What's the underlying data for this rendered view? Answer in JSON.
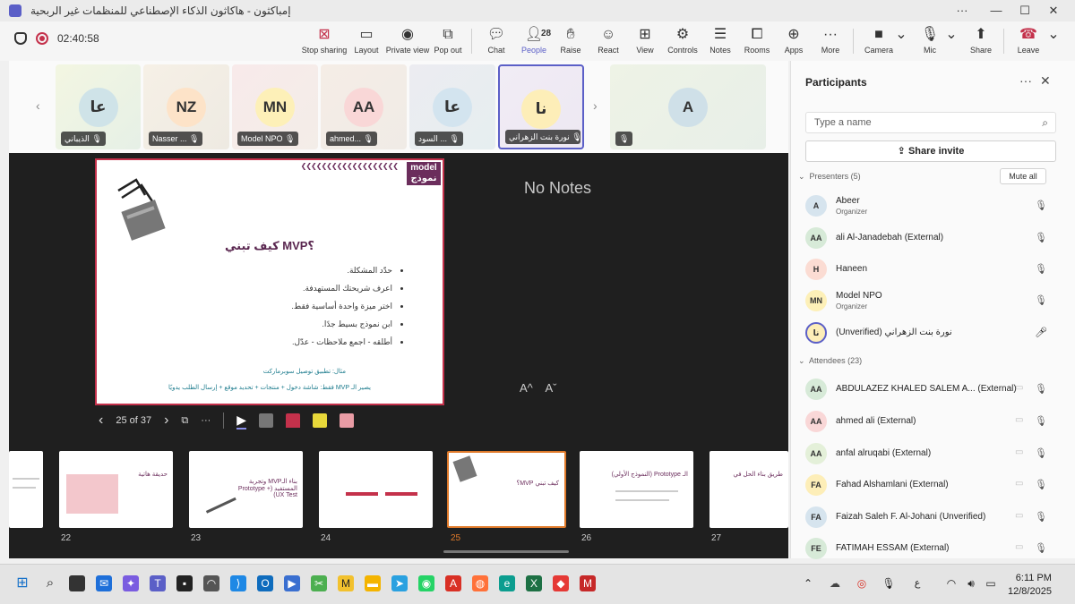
{
  "window": {
    "title": "إمباكثون - هاكاثون الذكاء الإصطناعي للمنظمات غير الربحية",
    "minimize": "—",
    "maximize": "☐",
    "close": "✕"
  },
  "meeting": {
    "timer": "02:40:58",
    "toolbar": {
      "stop_sharing": "Stop sharing",
      "layout": "Layout",
      "private_view": "Private view",
      "pop_out": "Pop out",
      "chat": "Chat",
      "people": "People",
      "people_count": "28",
      "raise": "Raise",
      "react": "React",
      "view": "View",
      "controls": "Controls",
      "notes": "Notes",
      "rooms": "Rooms",
      "apps": "Apps",
      "more": "More",
      "camera": "Camera",
      "mic": "Mic",
      "share": "Share",
      "leave": "Leave"
    }
  },
  "tiles": [
    {
      "initials": "عا",
      "name": "الذيباني",
      "color": "#cfe3e8"
    },
    {
      "initials": "NZ",
      "name": "Nasser ...",
      "color": "#fde3c8"
    },
    {
      "initials": "MN",
      "name": "Model NPO",
      "color": "#fdf0b8"
    },
    {
      "initials": "AA",
      "name": "ahmed...",
      "color": "#f9d7d7"
    },
    {
      "initials": "عا",
      "name": "السود ...",
      "color": "#d3e4ef"
    },
    {
      "initials": "نا",
      "name": "نورة بنت الزهراني",
      "color": "#fdeeb8"
    },
    {
      "initials": "A",
      "name": "",
      "color": "#cfe0e8"
    }
  ],
  "slide": {
    "logo_line1": "model",
    "logo_line2": "نموذج",
    "title": "كيف تبني MVP؟",
    "bullets": [
      "حدّد المشكلة.",
      "اعرف شريحتك المستهدفة.",
      "اختر ميزة واحدة أساسية فقط.",
      "ابن نموذج بسيط جدًا.",
      "أطلقه - اجمع ملاحظات - عدّل."
    ],
    "example_line1": "مثال: تطبيق توصيل سوبرماركت",
    "example_line2": "يصير الـ MVP فقط: شاشة دخول + منتجات + تحديد موقع + إرسال الطلب يدويًا"
  },
  "notes": {
    "empty": "No Notes",
    "font_increase": "A^",
    "font_decrease": "Aˇ"
  },
  "slide_nav": {
    "position": "25 of 37"
  },
  "thumbnails": [
    {
      "number": "22",
      "text": "حديقة هاتية"
    },
    {
      "number": "23",
      "text": "بناء الـMVP وتجربة المستفيد (Prototype + UX Test)"
    },
    {
      "number": "24",
      "text": ""
    },
    {
      "number": "25",
      "text": "كيف تبني MVP؟"
    },
    {
      "number": "26",
      "text": "الـ Prototype (النموذج الأولي)"
    },
    {
      "number": "27",
      "text": "طريق بناء الحل في"
    }
  ],
  "participants": {
    "title": "Participants",
    "search_placeholder": "Type a name",
    "share_invite": "Share invite",
    "presenters_label": "Presenters (5)",
    "mute_all": "Mute all",
    "attendees_label": "Attendees (23)",
    "presenters": [
      {
        "initials": "A",
        "name": "Abeer",
        "role": "Organizer",
        "color": "#d6e4ee"
      },
      {
        "initials": "AA",
        "name": "ali Al-Janadebah (External)",
        "role": "",
        "color": "#d7ead8"
      },
      {
        "initials": "H",
        "name": "Haneen",
        "role": "",
        "color": "#fbdcd3"
      },
      {
        "initials": "MN",
        "name": "Model NPO",
        "role": "Organizer",
        "color": "#fdf0b8"
      },
      {
        "initials": "نا",
        "name": "(Unverified) نورة بنت الزهراني",
        "role": "",
        "color": "#fdeeb8"
      }
    ],
    "attendees": [
      {
        "initials": "AA",
        "name": "ABDULAZEZ KHALED SALEM A... (External)",
        "color": "#d7ead8"
      },
      {
        "initials": "AA",
        "name": "ahmed ali (External)",
        "color": "#f9d7d7"
      },
      {
        "initials": "AA",
        "name": "anfal alruqabi (External)",
        "color": "#e4f0d9"
      },
      {
        "initials": "FA",
        "name": "Fahad Alshamlani (External)",
        "color": "#fdeeb8"
      },
      {
        "initials": "FA",
        "name": "Faizah Saleh F. Al-Johani (Unverified)",
        "color": "#d6e4ee"
      },
      {
        "initials": "FE",
        "name": "FATIMAH ESSAM (External)",
        "color": "#d7ead8"
      }
    ]
  },
  "taskbar": {
    "time": "6:11 PM",
    "date": "12/8/2025",
    "lang": "ع"
  }
}
